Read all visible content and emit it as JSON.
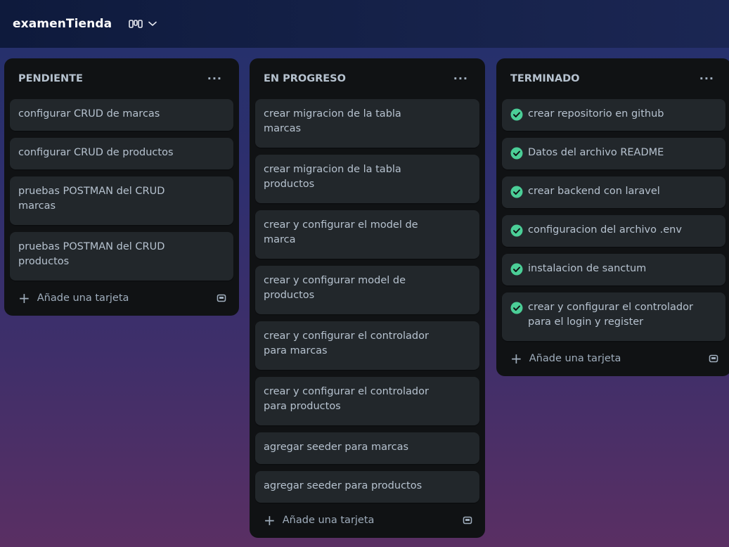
{
  "board": {
    "title": "examenTienda",
    "view_icon": "board-view-icon",
    "chevron_icon": "chevron-down-icon"
  },
  "colors": {
    "list_bg": "#101214",
    "card_bg": "#22272b",
    "text": "#b6c2cf",
    "check_green": "#4bce97"
  },
  "lists": [
    {
      "title": "PENDIENTE",
      "menu": "···",
      "add_label": "Añade una tarjeta",
      "cards": [
        {
          "text": "configurar CRUD de marcas"
        },
        {
          "text": "configurar CRUD de productos"
        },
        {
          "text": "pruebas POSTMAN del CRUD marcas"
        },
        {
          "text": "pruebas POSTMAN del CRUD productos"
        }
      ]
    },
    {
      "title": "EN PROGRESO",
      "menu": "···",
      "add_label": "Añade una tarjeta",
      "cards": [
        {
          "text": "crear migracion de la tabla marcas"
        },
        {
          "text": "crear migracion de la tabla productos"
        },
        {
          "text": "crear y configurar el model de marca"
        },
        {
          "text": "crear y configurar model de productos"
        },
        {
          "text": "crear y configurar el controlador para marcas"
        },
        {
          "text": "crear y configurar el controlador para productos"
        },
        {
          "text": "agregar seeder para marcas"
        },
        {
          "text": "agregar seeder para productos"
        }
      ]
    },
    {
      "title": "TERMINADO",
      "menu": "···",
      "add_label": "Añade una tarjeta",
      "cards": [
        {
          "text": "crear repositorio en github",
          "done": true
        },
        {
          "text": "Datos del archivo README",
          "done": true
        },
        {
          "text": "crear backend con laravel",
          "done": true
        },
        {
          "text": "configuracion del archivo .env",
          "done": true
        },
        {
          "text": "instalacion de sanctum",
          "done": true
        },
        {
          "text": "crear y configurar el controlador para el login y register",
          "done": true
        }
      ]
    }
  ]
}
